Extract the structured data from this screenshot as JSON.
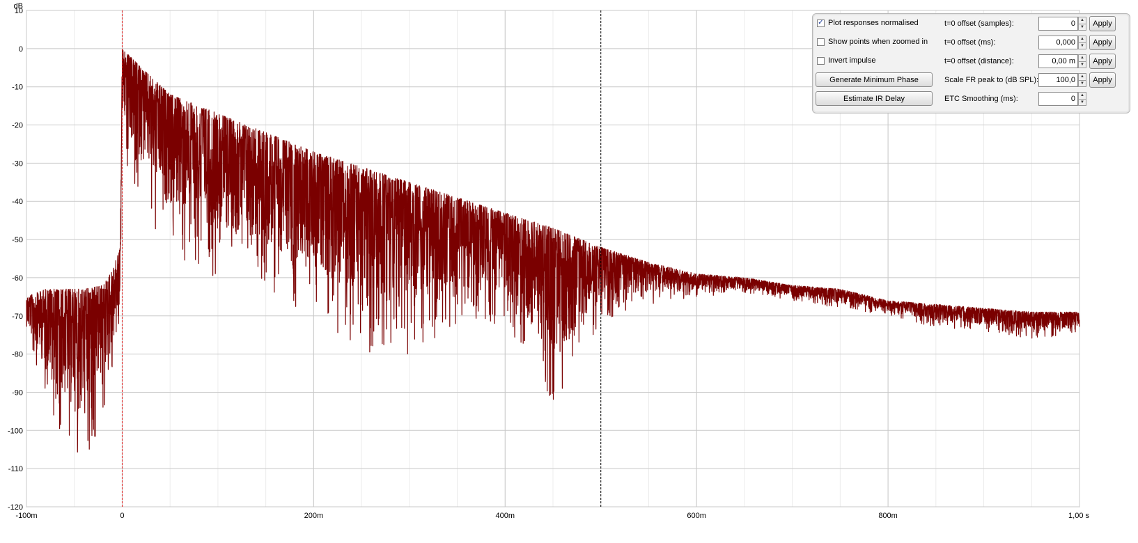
{
  "chart_data": {
    "type": "line",
    "ylabel": "dB",
    "xlabel": "",
    "xlim": [
      -0.1,
      1.0
    ],
    "ylim": [
      -120,
      10
    ],
    "xticks": [
      {
        "value": -0.1,
        "label": "-100m"
      },
      {
        "value": 0,
        "label": "0"
      },
      {
        "value": 0.2,
        "label": "200m"
      },
      {
        "value": 0.4,
        "label": "400m"
      },
      {
        "value": 0.6,
        "label": "600m"
      },
      {
        "value": 0.8,
        "label": "800m"
      },
      {
        "value": 1.0,
        "label": "1,00 s"
      }
    ],
    "yticks": [
      {
        "value": 10,
        "label": "10"
      },
      {
        "value": 0,
        "label": "0"
      },
      {
        "value": -10,
        "label": "-10"
      },
      {
        "value": -20,
        "label": "-20"
      },
      {
        "value": -30,
        "label": "-30"
      },
      {
        "value": -40,
        "label": "-40"
      },
      {
        "value": -50,
        "label": "-50"
      },
      {
        "value": -60,
        "label": "-60"
      },
      {
        "value": -70,
        "label": "-70"
      },
      {
        "value": -80,
        "label": "-80"
      },
      {
        "value": -90,
        "label": "-90"
      },
      {
        "value": -100,
        "label": "-100"
      },
      {
        "value": -110,
        "label": "-110"
      },
      {
        "value": -120,
        "label": "-120"
      }
    ],
    "x_minor_step": 0.05,
    "grid": true,
    "markers": [
      {
        "x": 0,
        "color": "#e02020"
      },
      {
        "x": 0.5,
        "color": "#000000"
      }
    ],
    "series": [
      {
        "color": "#7a0000",
        "envelope": [
          {
            "x": -0.1,
            "upper": -65,
            "lower": -76
          },
          {
            "x": -0.08,
            "upper": -63,
            "lower": -93
          },
          {
            "x": -0.06,
            "upper": -63,
            "lower": -104
          },
          {
            "x": -0.04,
            "upper": -63,
            "lower": -113
          },
          {
            "x": -0.02,
            "upper": -62,
            "lower": -95
          },
          {
            "x": -0.01,
            "upper": -58,
            "lower": -88
          },
          {
            "x": -0.002,
            "upper": -52,
            "lower": -72
          },
          {
            "x": 0,
            "upper": 0,
            "lower": -28
          },
          {
            "x": 0.02,
            "upper": -5,
            "lower": -40
          },
          {
            "x": 0.05,
            "upper": -12,
            "lower": -55
          },
          {
            "x": 0.1,
            "upper": -17,
            "lower": -60
          },
          {
            "x": 0.15,
            "upper": -22,
            "lower": -64
          },
          {
            "x": 0.2,
            "upper": -27,
            "lower": -70
          },
          {
            "x": 0.25,
            "upper": -31,
            "lower": -80
          },
          {
            "x": 0.3,
            "upper": -35,
            "lower": -80
          },
          {
            "x": 0.35,
            "upper": -39,
            "lower": -72
          },
          {
            "x": 0.4,
            "upper": -43,
            "lower": -72
          },
          {
            "x": 0.45,
            "upper": -47,
            "lower": -95
          },
          {
            "x": 0.5,
            "upper": -52,
            "lower": -72
          },
          {
            "x": 0.55,
            "upper": -56,
            "lower": -67
          },
          {
            "x": 0.6,
            "upper": -59,
            "lower": -65
          },
          {
            "x": 0.65,
            "upper": -60,
            "lower": -64
          },
          {
            "x": 0.7,
            "upper": -62,
            "lower": -66
          },
          {
            "x": 0.75,
            "upper": -63,
            "lower": -68
          },
          {
            "x": 0.8,
            "upper": -66,
            "lower": -70
          },
          {
            "x": 0.85,
            "upper": -67,
            "lower": -73
          },
          {
            "x": 0.9,
            "upper": -68,
            "lower": -74
          },
          {
            "x": 0.95,
            "upper": -69,
            "lower": -76
          },
          {
            "x": 1.0,
            "upper": -69,
            "lower": -75
          }
        ]
      }
    ]
  },
  "panel": {
    "checkboxes": [
      {
        "label": "Plot responses normalised",
        "checked": true
      },
      {
        "label": "Show points when zoomed in",
        "checked": false
      },
      {
        "label": "Invert impulse",
        "checked": false
      }
    ],
    "buttons": [
      {
        "label": "Generate Minimum Phase"
      },
      {
        "label": "Estimate IR Delay"
      }
    ],
    "fields": [
      {
        "label": "t=0 offset (samples):",
        "value": "0",
        "apply": "Apply"
      },
      {
        "label": "t=0 offset (ms):",
        "value": "0,000",
        "apply": "Apply"
      },
      {
        "label": "t=0 offset (distance):",
        "value": "0,00 m",
        "apply": "Apply"
      },
      {
        "label": "Scale FR peak to (dB SPL):",
        "value": "100,0",
        "apply": "Apply"
      },
      {
        "label": "ETC Smoothing (ms):",
        "value": "0",
        "apply": ""
      }
    ],
    "spin_up_icon": "▲",
    "spin_down_icon": "▼",
    "check_mark_icon": "✓"
  }
}
